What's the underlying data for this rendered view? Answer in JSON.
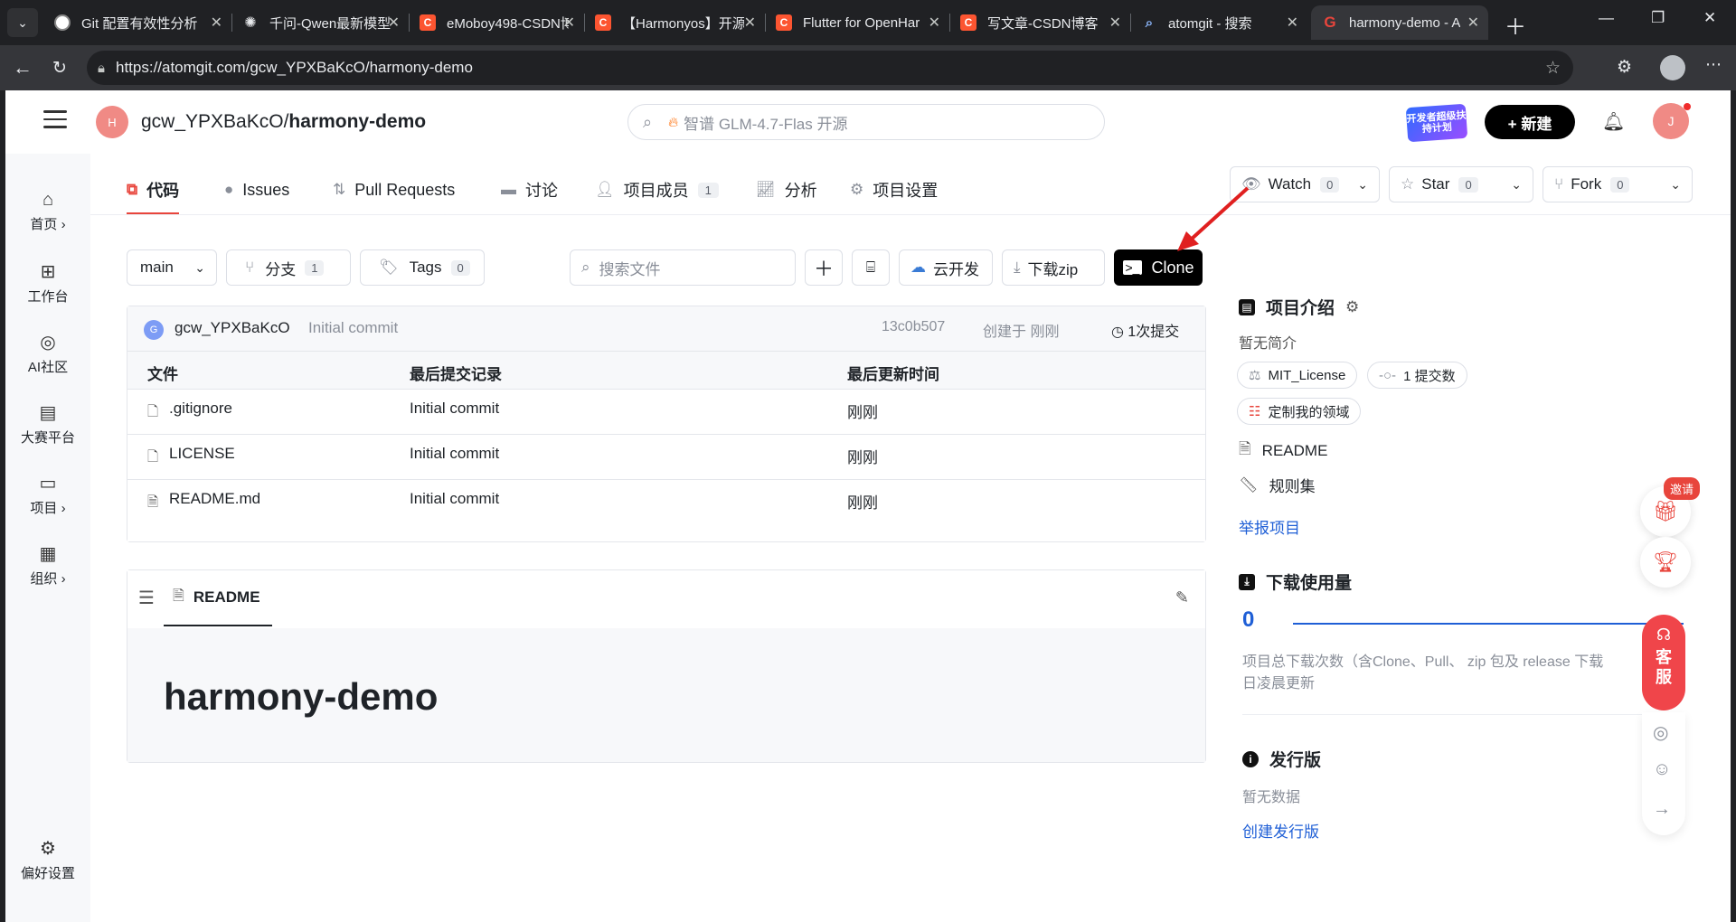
{
  "browser": {
    "tabs": [
      {
        "title": "Git 配置有效性分析",
        "icon": "git-avatar-icon"
      },
      {
        "title": "千问-Qwen最新模型",
        "icon": "qwen-icon"
      },
      {
        "title": "eMoboy498-CSDN博",
        "icon": "csdn-icon"
      },
      {
        "title": "【Harmonyos】开源",
        "icon": "csdn-icon"
      },
      {
        "title": "Flutter for OpenHar",
        "icon": "csdn-icon"
      },
      {
        "title": "写文章-CSDN博客",
        "icon": "csdn-icon"
      },
      {
        "title": "atomgit - 搜索",
        "icon": "search-icon"
      },
      {
        "title": "harmony-demo - A",
        "icon": "gitcode-icon",
        "active": true
      }
    ],
    "url": "https://atomgit.com/gcw_YPXBaKcO/harmony-demo"
  },
  "header": {
    "repo_avatar_letter": "H",
    "owner": "gcw_YPXBaKcO/",
    "repo": "harmony-demo",
    "search_placeholder": "智谱 GLM-4.7-Flas 开源",
    "promo_text": "开发者超级扶持计划",
    "new_label": "+ 新建",
    "user_letter": "J"
  },
  "sidebar": {
    "items": [
      {
        "label": "首页 ›",
        "icon": "home-icon"
      },
      {
        "label": "工作台",
        "icon": "dashboard-icon"
      },
      {
        "label": "AI社区",
        "icon": "ai-icon"
      },
      {
        "label": "大赛平台",
        "icon": "trophy-board-icon"
      },
      {
        "label": "项目 ›",
        "icon": "folder-icon"
      },
      {
        "label": "组织 ›",
        "icon": "building-icon"
      }
    ],
    "settings_label": "偏好设置"
  },
  "repo_tabs": [
    {
      "label": "代码",
      "icon": "code-icon",
      "active": true
    },
    {
      "label": "Issues",
      "icon": "issue-icon"
    },
    {
      "label": "Pull Requests",
      "icon": "pull-request-icon"
    },
    {
      "label": "讨论",
      "icon": "discussion-icon"
    },
    {
      "label": "项目成员",
      "icon": "members-icon",
      "count": "1"
    },
    {
      "label": "分析",
      "icon": "chart-icon"
    },
    {
      "label": "项目设置",
      "icon": "gear-icon"
    }
  ],
  "actions": {
    "watch": {
      "label": "Watch",
      "count": "0"
    },
    "star": {
      "label": "Star",
      "count": "0"
    },
    "fork": {
      "label": "Fork",
      "count": "0"
    }
  },
  "file_toolbar": {
    "branch": "main",
    "branches_label": "分支",
    "branches_count": "1",
    "tags_label": "Tags",
    "tags_count": "0",
    "search_placeholder": "搜索文件",
    "cloud_dev": "云开发",
    "download_zip": "下载zip",
    "clone": "Clone"
  },
  "last_commit": {
    "avatar_letter": "G",
    "author": "gcw_YPXBaKcO",
    "message": "Initial commit",
    "sha": "13c0b507",
    "time": "创建于 刚刚",
    "total": "1次提交"
  },
  "files": {
    "headers": [
      "文件",
      "最后提交记录",
      "最后更新时间"
    ],
    "rows": [
      {
        "name": ".gitignore",
        "commit": "Initial commit",
        "time": "刚刚"
      },
      {
        "name": "LICENSE",
        "commit": "Initial commit",
        "time": "刚刚"
      },
      {
        "name": "README.md",
        "commit": "Initial commit",
        "time": "刚刚"
      }
    ]
  },
  "readme": {
    "tab_label": "README",
    "heading": "harmony-demo"
  },
  "about": {
    "title": "项目介绍",
    "description": "暂无简介",
    "license": "MIT_License",
    "commits": "1 提交数",
    "customize": "定制我的领域",
    "readme": "README",
    "rules": "规则集",
    "report": "举报项目"
  },
  "downloads": {
    "title": "下载使用量",
    "count": "0",
    "note": "项目总下载次数（含Clone、Pull、 zip 包及 release 下载",
    "note2": "日凌晨更新"
  },
  "releases": {
    "title": "发行版",
    "empty": "暂无数据",
    "create": "创建发行版"
  },
  "widgets": {
    "invite": "邀请",
    "service": "客服"
  },
  "colors": {
    "accent": "#e8453c",
    "link": "#1f5fd6"
  }
}
